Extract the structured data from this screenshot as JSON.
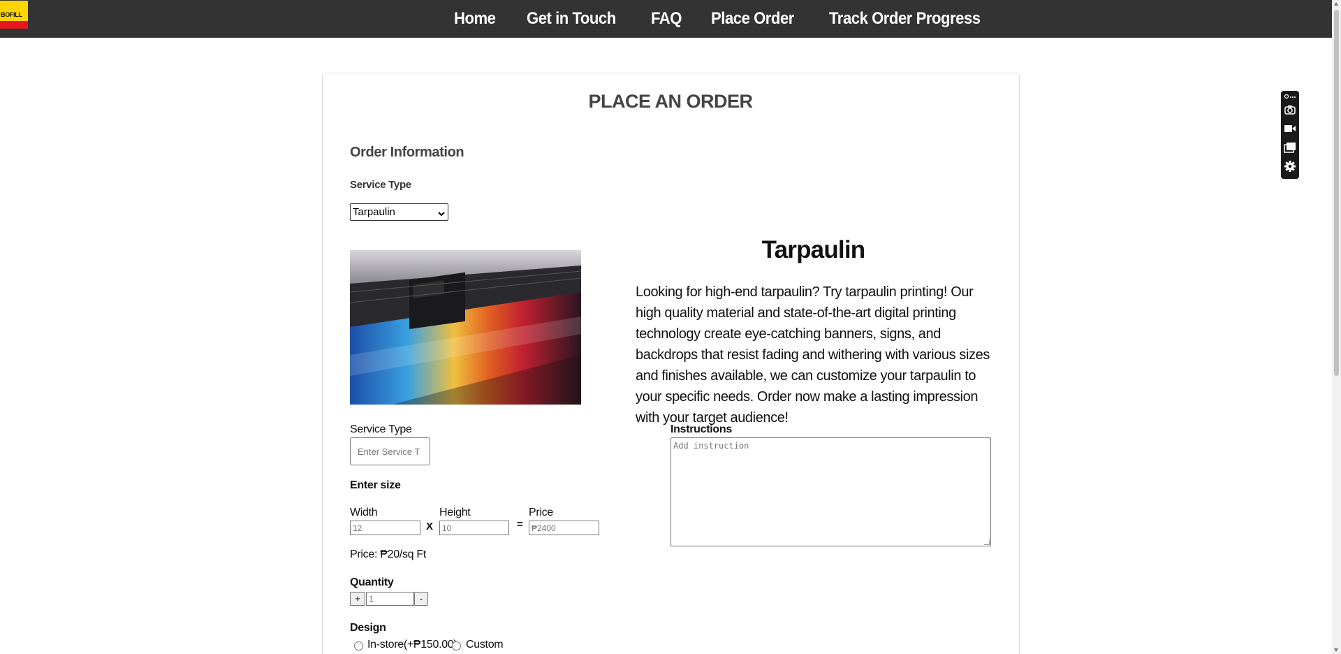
{
  "nav": {
    "logo_text": "BOFILL",
    "links": [
      "Home",
      "Get in Touch",
      "FAQ",
      "Place Order",
      "Track Order Progress"
    ]
  },
  "page_title": "PLACE AN ORDER",
  "order_info": {
    "heading": "Order Information",
    "service_type_label": "Service Type",
    "service_type_selected": "Tarpaulin"
  },
  "product": {
    "title": "Tarpaulin",
    "description": "Looking for high-end tarpaulin? Try tarpaulin printing! Our high quality material and state-of-the-art digital printing technology create eye-catching banners, signs, and backdrops that resist fading and withering with various sizes and finishes available, we can customize your tarpaulin to your specific needs. Order now make a lasting impression with your target audience!"
  },
  "form": {
    "service_type_label": "Service Type",
    "service_type_placeholder": "Enter Service T",
    "size_heading": "Enter size",
    "width_label": "Width",
    "width_value": "12",
    "x_symbol": "X",
    "height_label": "Height",
    "height_value": "10",
    "equals_symbol": "=",
    "price_label": "Price",
    "price_value": "₱2400",
    "unit_price": "Price: ₱20/sq Ft",
    "quantity_label": "Quantity",
    "quantity_value": "1",
    "plus_label": "+",
    "minus_label": "-",
    "design_label": "Design",
    "design_options": [
      "In-store(+₱150.00)",
      "Custom"
    ],
    "instructions_label": "Instructions",
    "instructions_placeholder": "Add instruction"
  },
  "colors": {
    "nav_bg": "#333333",
    "logo_yellow": "#ffd400",
    "logo_red": "#e8171b"
  },
  "icons": [
    "chevron-down-icon",
    "link-icon",
    "more-icon",
    "camera-icon",
    "video-icon",
    "window-icon",
    "gear-icon"
  ]
}
